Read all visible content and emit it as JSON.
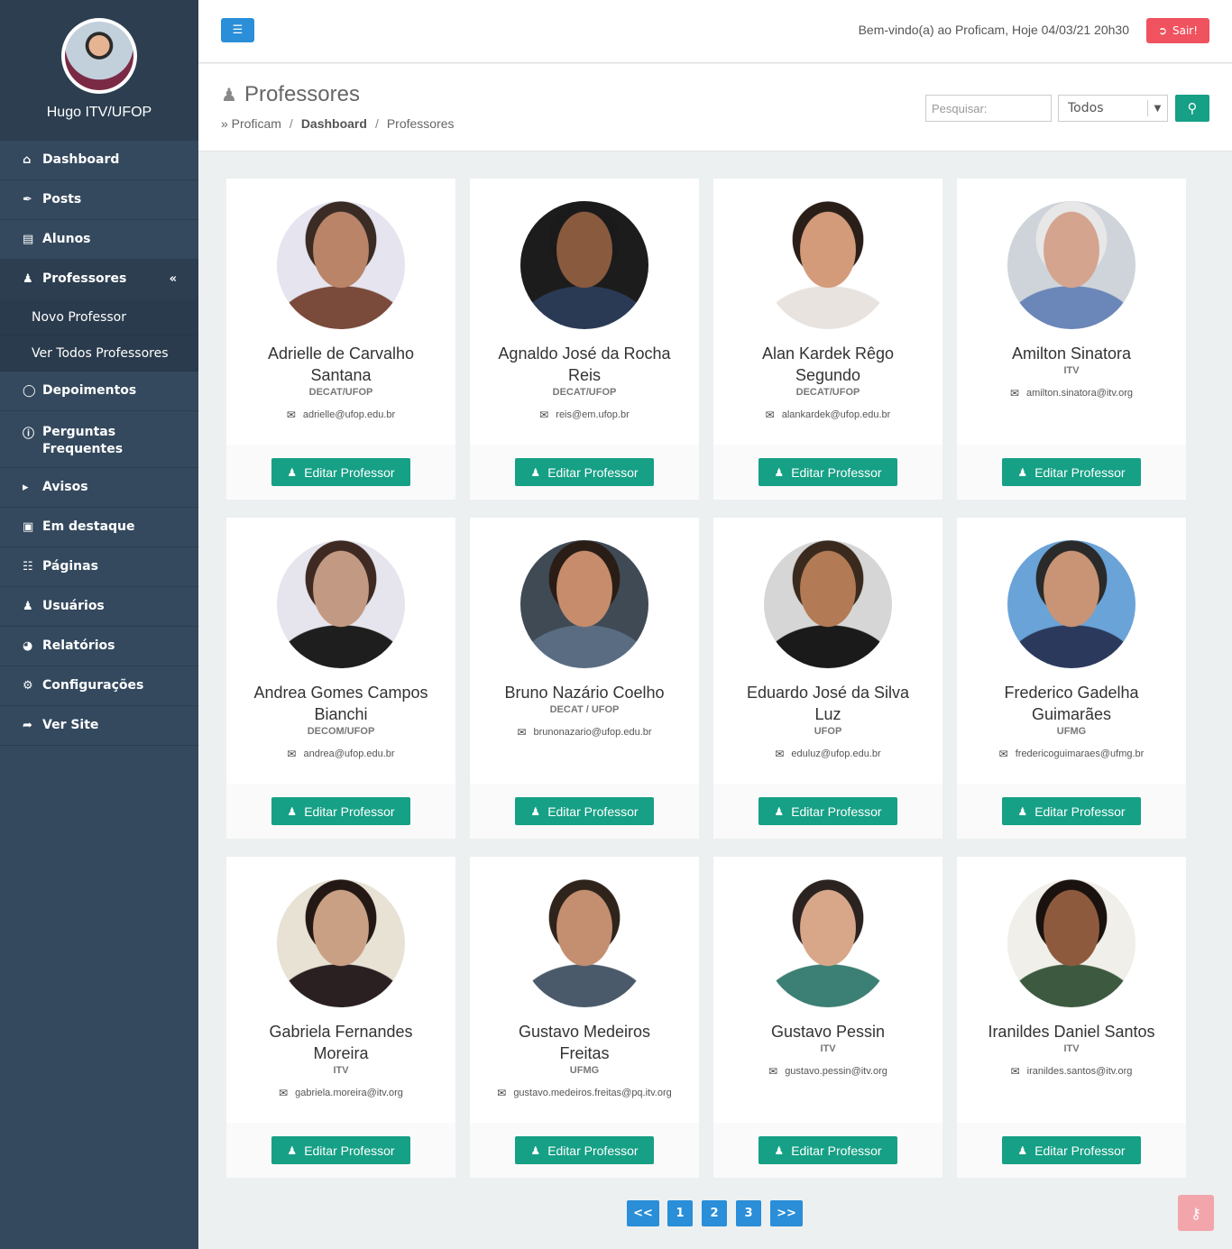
{
  "profile": {
    "name": "Hugo ITV/UFOP"
  },
  "sidebar": {
    "items": [
      {
        "label": "Dashboard",
        "icon": "home-icon"
      },
      {
        "label": "Posts",
        "icon": "feather-icon"
      },
      {
        "label": "Alunos",
        "icon": "id-card-icon"
      },
      {
        "label": "Professores",
        "icon": "user-icon",
        "active": true,
        "chevron": "«"
      },
      {
        "label": "Depoimentos",
        "icon": "comment-icon"
      },
      {
        "label": "Perguntas Frequentes",
        "icon": "question-icon"
      },
      {
        "label": "Avisos",
        "icon": "megaphone-icon"
      },
      {
        "label": "Em destaque",
        "icon": "image-icon"
      },
      {
        "label": "Páginas",
        "icon": "sitemap-icon"
      },
      {
        "label": "Usuários",
        "icon": "users-icon"
      },
      {
        "label": "Relatórios",
        "icon": "pie-chart-icon"
      },
      {
        "label": "Configurações",
        "icon": "gears-icon"
      },
      {
        "label": "Ver Site",
        "icon": "share-icon"
      }
    ],
    "sub_items": [
      "Novo Professor",
      "Ver Todos Professores"
    ]
  },
  "topbar": {
    "welcome": "Bem-vindo(a) ao Proficam, Hoje 04/03/21 20h30",
    "logout_label": "Sair!"
  },
  "page": {
    "title": "Professores",
    "breadcrumb": [
      "» Proficam",
      "Dashboard",
      "Professores"
    ]
  },
  "search": {
    "placeholder": "Pesquisar:",
    "filter_value": "Todos",
    "button_icon": "search-icon"
  },
  "professors": [
    {
      "name": "Adrielle de Carvalho Santana",
      "inst": "DECAT/UFOP",
      "email": "adrielle@ufop.edu.br",
      "photo_bg": "#e5e4ef",
      "skin": "#b98468",
      "hair": "#3a2b24",
      "shirt": "#7a4a3a"
    },
    {
      "name": "Agnaldo José da Rocha Reis",
      "inst": "DECAT/UFOP",
      "email": "reis@em.ufop.br",
      "photo_bg": "#1c1c1c",
      "skin": "#8a5a3e",
      "hair": "#1a1a1a",
      "shirt": "#2a3a55"
    },
    {
      "name": "Alan Kardek Rêgo Segundo",
      "inst": "DECAT/UFOP",
      "email": "alankardek@ufop.edu.br",
      "photo_bg": "#ffffff",
      "skin": "#d39b7a",
      "hair": "#2a1e18",
      "shirt": "#e9e3e0"
    },
    {
      "name": "Amilton Sinatora",
      "inst": "ITV",
      "email": "amilton.sinatora@itv.org",
      "photo_bg": "#cfd4da",
      "skin": "#d4a48e",
      "hair": "#e7e7e7",
      "shirt": "#6b86b8"
    },
    {
      "name": "Andrea Gomes Campos Bianchi",
      "inst": "DECOM/UFOP",
      "email": "andrea@ufop.edu.br",
      "photo_bg": "#e6e4ec",
      "skin": "#c29a84",
      "hair": "#3e2a22",
      "shirt": "#1e1e1e"
    },
    {
      "name": "Bruno Nazário Coelho",
      "inst": "DECAT / UFOP",
      "email": "brunonazario@ufop.edu.br",
      "photo_bg": "#3f4a55",
      "skin": "#c68c6c",
      "hair": "#2a1d16",
      "shirt": "#5a6c82"
    },
    {
      "name": "Eduardo José da Silva Luz",
      "inst": "UFOP",
      "email": "eduluz@ufop.edu.br",
      "photo_bg": "#d6d6d6",
      "skin": "#b27a55",
      "hair": "#3a2a1e",
      "shirt": "#1a1a1a"
    },
    {
      "name": "Frederico Gadelha Guimarães",
      "inst": "UFMG",
      "email": "fredericoguimaraes@ufmg.br",
      "photo_bg": "#6aa3d8",
      "skin": "#c89475",
      "hair": "#2a2a2a",
      "shirt": "#2b3a5c"
    },
    {
      "name": "Gabriela Fernandes Moreira",
      "inst": "ITV",
      "email": "gabriela.moreira@itv.org",
      "photo_bg": "#e8e2d5",
      "skin": "#caa085",
      "hair": "#231813",
      "shirt": "#2a2022"
    },
    {
      "name": "Gustavo Medeiros Freitas",
      "inst": "UFMG",
      "email": "gustavo.medeiros.freitas@pq.itv.org",
      "photo_bg": "#ffffff",
      "skin": "#c48e70",
      "hair": "#2e241c",
      "shirt": "#4b5a6a"
    },
    {
      "name": "Gustavo Pessin",
      "inst": "ITV",
      "email": "gustavo.pessin@itv.org",
      "photo_bg": "#ffffff",
      "skin": "#d8a78a",
      "hair": "#2b2320",
      "shirt": "#3c7f74"
    },
    {
      "name": "Iranildes Daniel Santos",
      "inst": "ITV",
      "email": "iranildes.santos@itv.org",
      "photo_bg": "#f1efea",
      "skin": "#8e5a3e",
      "hair": "#1a120e",
      "shirt": "#3d5a40"
    }
  ],
  "card": {
    "edit_label": "Editar Professor"
  },
  "pagination": {
    "prev": "<<",
    "pages": [
      "1",
      "2",
      "3"
    ],
    "next": ">>"
  },
  "colors": {
    "sidebar": "#34495e",
    "accent_green": "#16a085",
    "accent_blue": "#2a8ed8",
    "logout_red": "#f0525f"
  }
}
